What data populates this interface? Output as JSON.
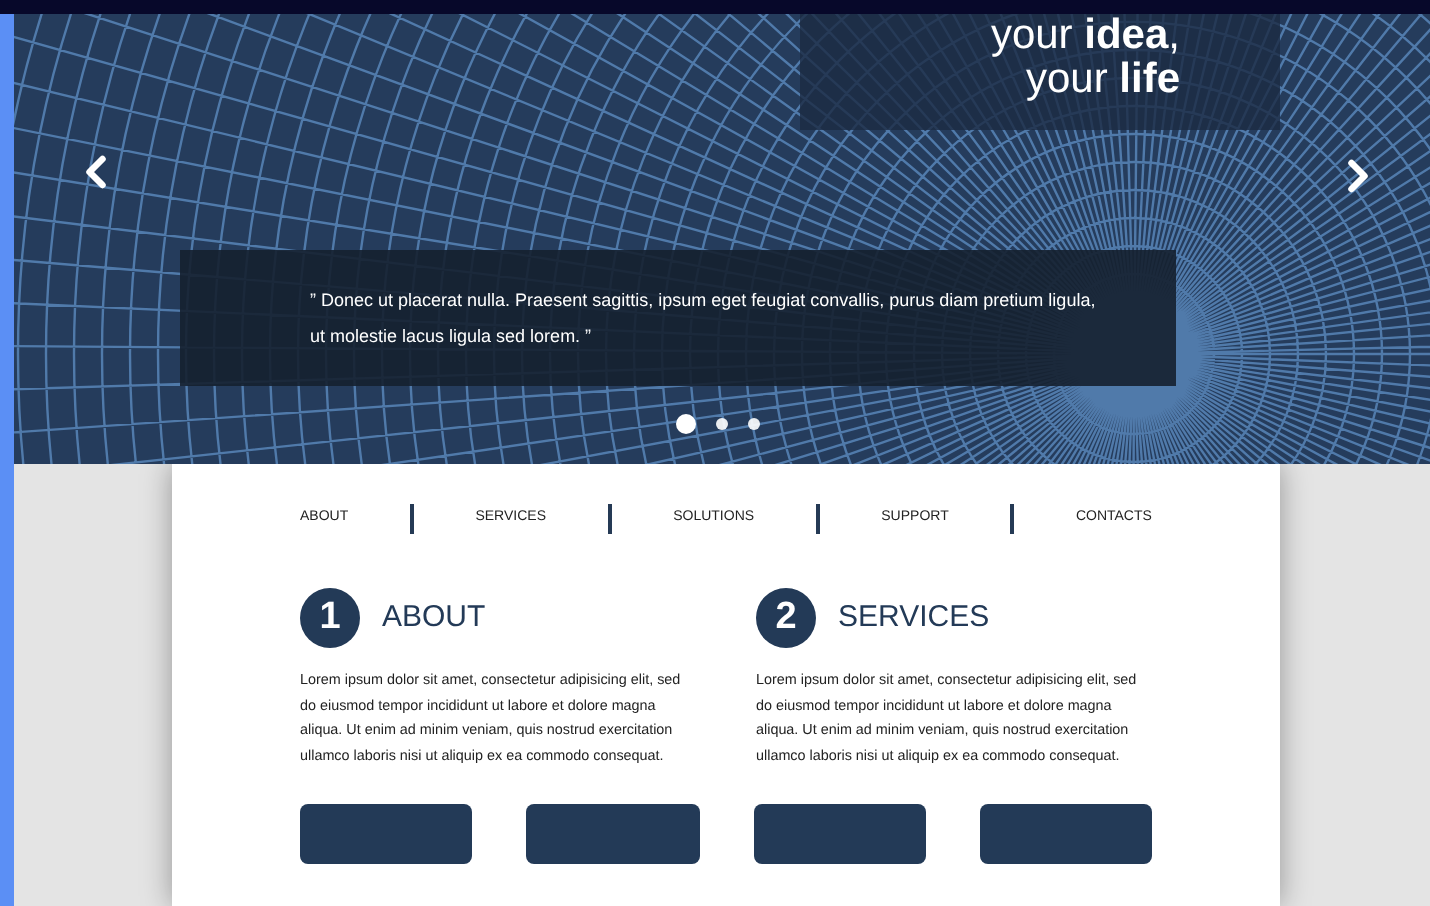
{
  "slider": {
    "headline": [
      "your **idea**,",
      "your **life**"
    ],
    "quote": "” Donec ut placerat nulla. Praesent sagittis, ipsum eget feugiat convallis, purus diam pretium ligula, ut molestie lacus ligula sed lorem. ”",
    "dots": [
      {
        "selected": true
      },
      {
        "selected": false
      },
      {
        "selected": false
      }
    ]
  },
  "nav": [
    {
      "label": "ABOUT"
    },
    {
      "label": "SERVICES"
    },
    {
      "label": "SOLUTIONS"
    },
    {
      "label": "SUPPORT"
    },
    {
      "label": "CONTACTS"
    }
  ],
  "sections": [
    {
      "number": "1",
      "title": "ABOUT",
      "text": "Lorem ipsum dolor sit amet, consectetur adipisicing elit, sed do eiusmod tempor incididunt ut labore et dolore magna aliqua. Ut enim ad minim veniam, quis nostrud exercitation ullamco laboris nisi ut aliquip ex ea commodo consequat."
    },
    {
      "number": "2",
      "title": "SERVICES",
      "text": "Lorem ipsum dolor sit amet, consectetur adipisicing elit, sed do eiusmod tempor incididunt ut labore et dolore magna aliqua. Ut enim ad minim veniam, quis nostrud exercitation ullamco laboris nisi ut aliquip ex ea commodo consequat."
    }
  ]
}
